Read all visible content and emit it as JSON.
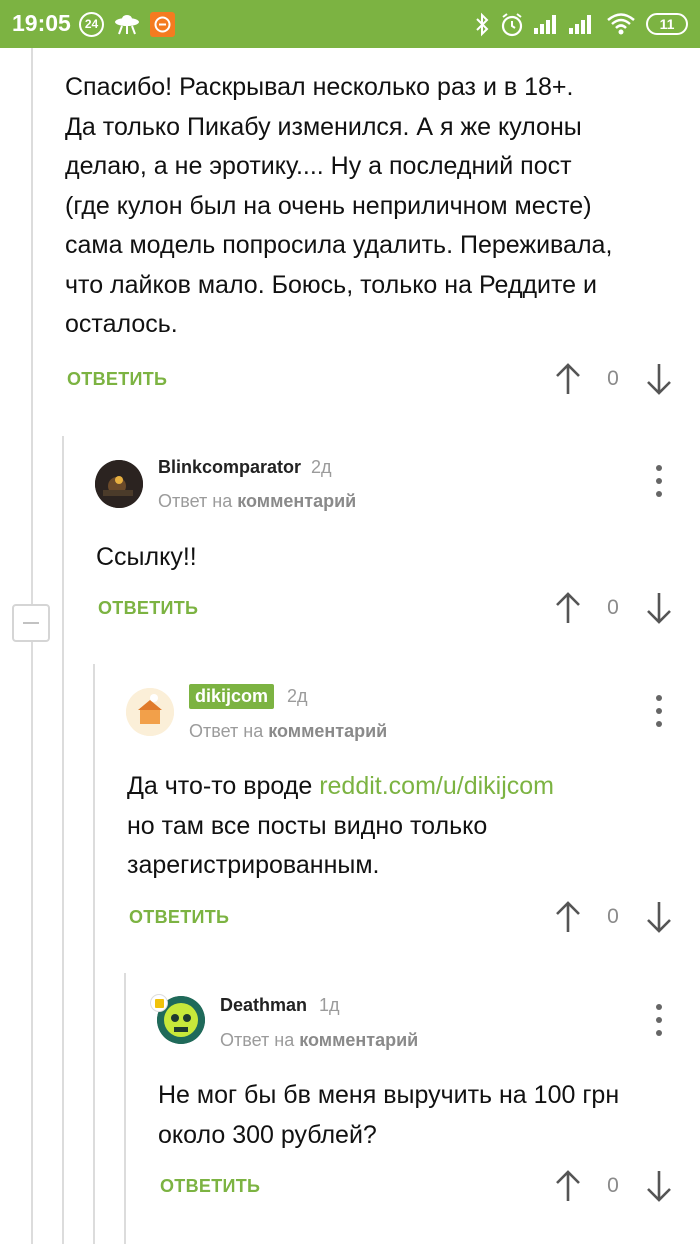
{
  "status_bar": {
    "time": "19:05",
    "notification_count": "24",
    "battery": "11"
  },
  "comments": [
    {
      "text": "Спасибо! Раскрывал несколько раз и в 18+. Да только Пикабу изменился. А я же кулоны делаю, а не эротику.... Ну а последний пост (где кулон был на очень неприличном месте) сама модель попросила удалить. Переживала, что лайков мало. Боюсь, только на Реддите и осталось.",
      "lines": [
        "Спасибо! Раскрывал несколько раз и в 18+.",
        "Да только Пикабу изменился. А я же кулоны",
        "делаю, а не эротику.... Ну а последний пост",
        "(где кулон был на очень неприличном месте)",
        "сама модель попросила удалить. Переживала,",
        "что лайков мало. Боюсь, только на Реддите и",
        "осталось."
      ],
      "reply_label": "ОТВЕТИТЬ",
      "score": "0"
    },
    {
      "username": "Blinkcomparator",
      "age": "2д",
      "reply_to_prefix": "Ответ на",
      "reply_to_target": "комментарий",
      "text": "Ссылку!!",
      "reply_label": "ОТВЕТИТЬ",
      "score": "0"
    },
    {
      "username": "dikijcom",
      "age": "2д",
      "reply_to_prefix": "Ответ на",
      "reply_to_target": "комментарий",
      "text_before_link": "Да что-то вроде ",
      "link": "reddit.com/u/dikijcom",
      "text_line2": "но там все посты видно только",
      "text_line3": "зарегистрированным.",
      "reply_label": "ОТВЕТИТЬ",
      "score": "0"
    },
    {
      "username": "Deathman",
      "age": "1д",
      "reply_to_prefix": "Ответ на",
      "reply_to_target": "комментарий",
      "text_line1": "Не мог бы бв меня выручить на 100 грн",
      "text_line2": "около 300 рублей?",
      "reply_label": "ОТВЕТИТЬ",
      "score": "0"
    }
  ],
  "icons": {
    "vote_up": "arrow-up-icon",
    "vote_down": "arrow-down-icon",
    "more": "more-vertical-icon",
    "collapse": "minus-icon"
  },
  "colors": {
    "accent": "#7cb342",
    "muted": "#9b9b9b",
    "thread": "#dcdcdc"
  }
}
